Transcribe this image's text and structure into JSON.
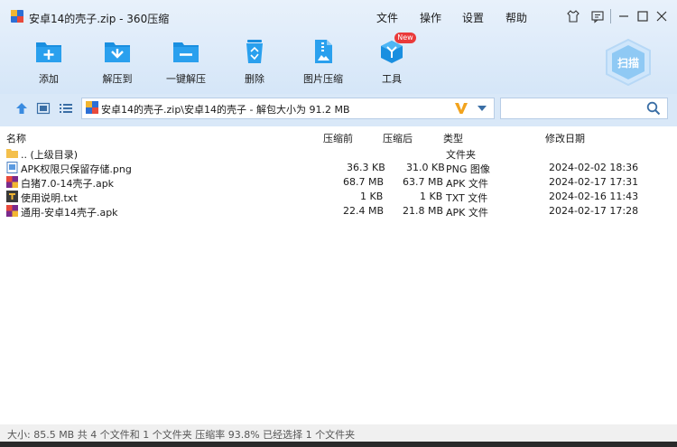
{
  "title": "安卓14的壳子.zip - 360压缩",
  "menu": [
    "文件",
    "操作",
    "设置",
    "帮助"
  ],
  "toolbar": {
    "add": "添加",
    "extract_to": "解压到",
    "one_click_extract": "一键解压",
    "delete": "删除",
    "image_compress": "图片压缩",
    "tools": "工具",
    "new_badge": "New",
    "scan": "扫描"
  },
  "address": {
    "path": "安卓14的壳子.zip\\安卓14的壳子 - 解包大小为 91.2 MB"
  },
  "search": {
    "placeholder": ""
  },
  "columns": {
    "name": "名称",
    "compressed": "压缩前",
    "after": "压缩后",
    "type": "类型",
    "modified": "修改日期"
  },
  "rows": [
    {
      "name": ".. (上级目录)",
      "before": "",
      "after": "",
      "type": "文件夹",
      "date": "",
      "icon": "folder"
    },
    {
      "name": "APK权限只保留存储.png",
      "before": "36.3 KB",
      "after": "31.0 KB",
      "type": "PNG 图像",
      "date": "2024-02-02 18:36",
      "icon": "png"
    },
    {
      "name": "白猪7.0-14壳子.apk",
      "before": "68.7 MB",
      "after": "63.7 MB",
      "type": "APK 文件",
      "date": "2024-02-17 17:31",
      "icon": "apk"
    },
    {
      "name": "使用说明.txt",
      "before": "1 KB",
      "after": "1 KB",
      "type": "TXT 文件",
      "date": "2024-02-16 11:43",
      "icon": "txt"
    },
    {
      "name": "通用-安卓14壳子.apk",
      "before": "22.4 MB",
      "after": "21.8 MB",
      "type": "APK 文件",
      "date": "2024-02-17 17:28",
      "icon": "apk"
    }
  ],
  "status": "大小: 85.5 MB 共 4 个文件和 1 个文件夹 压缩率 93.8% 已经选择 1 个文件夹",
  "colors": {
    "accent": "#1a8fe0",
    "band": "#dbe9f8"
  }
}
